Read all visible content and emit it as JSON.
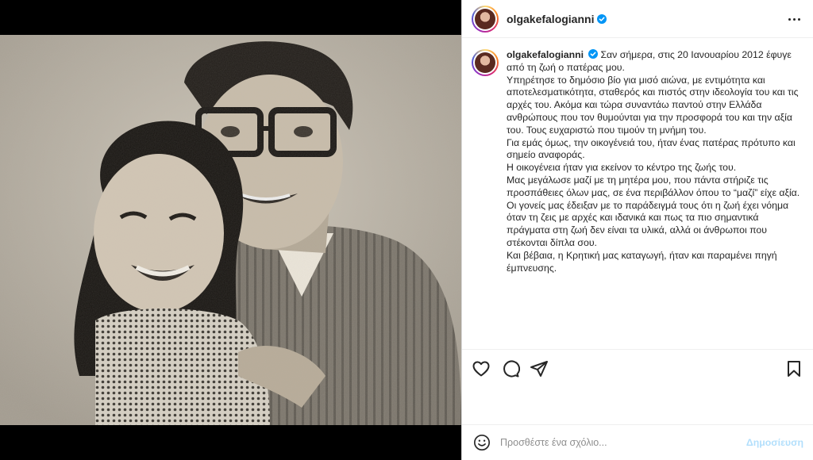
{
  "post": {
    "username": "olgakefalogianni",
    "verified": true,
    "photo_description_icon": "vintage-photo-couple"
  },
  "caption": {
    "username": "olgakefalogianni",
    "lines": [
      "Σαν σήμερα, στις 20 Ιανουαρίου 2012 έφυγε από τη ζωή ο πατέρας μου.",
      "Υπηρέτησε το δημόσιο βίο για μισό αιώνα, με εντιμότητα και αποτελεσματικότητα, σταθερός και πιστός στην ιδεολογία του και τις αρχές του. Ακόμα και τώρα συναντάω παντού στην Ελλάδα ανθρώπους που τον θυμούνται για την προσφορά του και την αξία του. Τους ευχαριστώ που τιμούν τη μνήμη του.",
      "Για εμάς όμως, την οικογένειά του, ήταν ένας πατέρας πρότυπο και σημείο αναφοράς.",
      "Η οικογένεια ήταν για εκείνον το κέντρο της ζωής του.",
      "Μας μεγάλωσε μαζί με τη μητέρα μου, που πάντα στήριζε τις προσπάθειες όλων μας, σε ένα περιβάλλον όπου το “μαζί” είχε αξία.",
      "Οι γονείς μας έδειξαν με το παράδειγμά τους ότι η ζωή έχει νόημα όταν τη ζεις με αρχές και ιδανικά και πως τα πιο σημαντικά πράγματα στη ζωή δεν είναι τα υλικά, αλλά οι άνθρωποι που στέκονται δίπλα σου.",
      "Και βέβαια, η Κρητική μας καταγωγή, ήταν και παραμένει πηγή έμπνευσης."
    ]
  },
  "actions": {
    "icons": [
      "heart-icon",
      "comment-icon",
      "share-icon",
      "bookmark-icon"
    ]
  },
  "comment_box": {
    "placeholder": "Προσθέστε ένα σχόλιο...",
    "value": "",
    "post_label": "Δημοσίευση"
  },
  "colors": {
    "verified_blue": "#0095f6",
    "post_button_disabled": "#b2dffc"
  }
}
